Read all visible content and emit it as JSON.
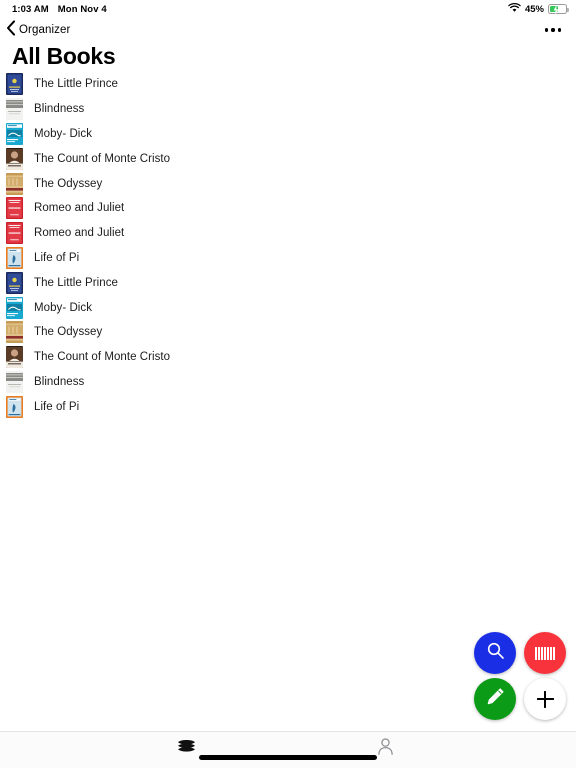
{
  "status_bar": {
    "time": "1:03 AM",
    "date": "Mon Nov 4",
    "battery_percent": "45%",
    "wifi_icon": "wifi-icon",
    "battery_icon": "battery-charging-icon"
  },
  "nav": {
    "back_label": "Organizer",
    "back_icon": "chevron-left-icon",
    "more_icon": "ellipsis-icon"
  },
  "page": {
    "title": "All Books"
  },
  "books": [
    {
      "title": "The Little Prince",
      "cover": "little-prince",
      "colors": [
        "#1b2a5e",
        "#2f4a96",
        "#e8d14a"
      ]
    },
    {
      "title": "Blindness",
      "cover": "blindness",
      "colors": [
        "#f2f2f0",
        "#8a8a86",
        "#cfcfca"
      ]
    },
    {
      "title": "Moby- Dick",
      "cover": "moby-dick",
      "colors": [
        "#19a8d0",
        "#0f7fa3",
        "#ffffff"
      ]
    },
    {
      "title": "The Count of Monte Cristo",
      "cover": "monte-cristo",
      "colors": [
        "#5a3b25",
        "#caa185",
        "#2b1a10"
      ]
    },
    {
      "title": "The Odyssey",
      "cover": "the-odyssey",
      "colors": [
        "#e0c089",
        "#c59a52",
        "#8d2f2a"
      ]
    },
    {
      "title": "Romeo and Juliet",
      "cover": "romeo-juliet",
      "colors": [
        "#c9202c",
        "#e23a46",
        "#ffffff"
      ]
    },
    {
      "title": "Romeo and Juliet",
      "cover": "romeo-juliet",
      "colors": [
        "#c9202c",
        "#e23a46",
        "#ffffff"
      ]
    },
    {
      "title": "Life of Pi",
      "cover": "life-of-pi",
      "colors": [
        "#e87d22",
        "#cfe3ef",
        "#2b6f9e"
      ]
    },
    {
      "title": "The Little Prince",
      "cover": "little-prince",
      "colors": [
        "#1b2a5e",
        "#2f4a96",
        "#e8d14a"
      ]
    },
    {
      "title": "Moby- Dick",
      "cover": "moby-dick",
      "colors": [
        "#19a8d0",
        "#0f7fa3",
        "#ffffff"
      ]
    },
    {
      "title": "The Odyssey",
      "cover": "the-odyssey",
      "colors": [
        "#e0c089",
        "#c59a52",
        "#8d2f2a"
      ]
    },
    {
      "title": "The Count of Monte Cristo",
      "cover": "monte-cristo",
      "colors": [
        "#5a3b25",
        "#caa185",
        "#2b1a10"
      ]
    },
    {
      "title": "Blindness",
      "cover": "blindness",
      "colors": [
        "#f2f2f0",
        "#8a8a86",
        "#cfcfca"
      ]
    },
    {
      "title": "Life of Pi",
      "cover": "life-of-pi",
      "colors": [
        "#e87d22",
        "#cfe3ef",
        "#2b6f9e"
      ]
    }
  ],
  "fabs": [
    {
      "name": "search-fab",
      "icon": "search-icon",
      "color": "#1a2ee6"
    },
    {
      "name": "scan-fab",
      "icon": "barcode-icon",
      "color": "#f8333c"
    },
    {
      "name": "edit-fab",
      "icon": "pencil-icon",
      "color": "#0b9b16"
    },
    {
      "name": "add-fab",
      "icon": "plus-icon",
      "color": "#ffffff"
    }
  ],
  "tab_bar": {
    "items": [
      {
        "name": "tab-books",
        "icon": "books-stack-icon",
        "active": true
      },
      {
        "name": "tab-profile",
        "icon": "person-icon",
        "active": false
      }
    ]
  },
  "theme": {
    "background": "#ffffff",
    "text": "#1c1c1e",
    "tabbar_bg": "#fbfbfb",
    "battery_green": "#34c759"
  }
}
